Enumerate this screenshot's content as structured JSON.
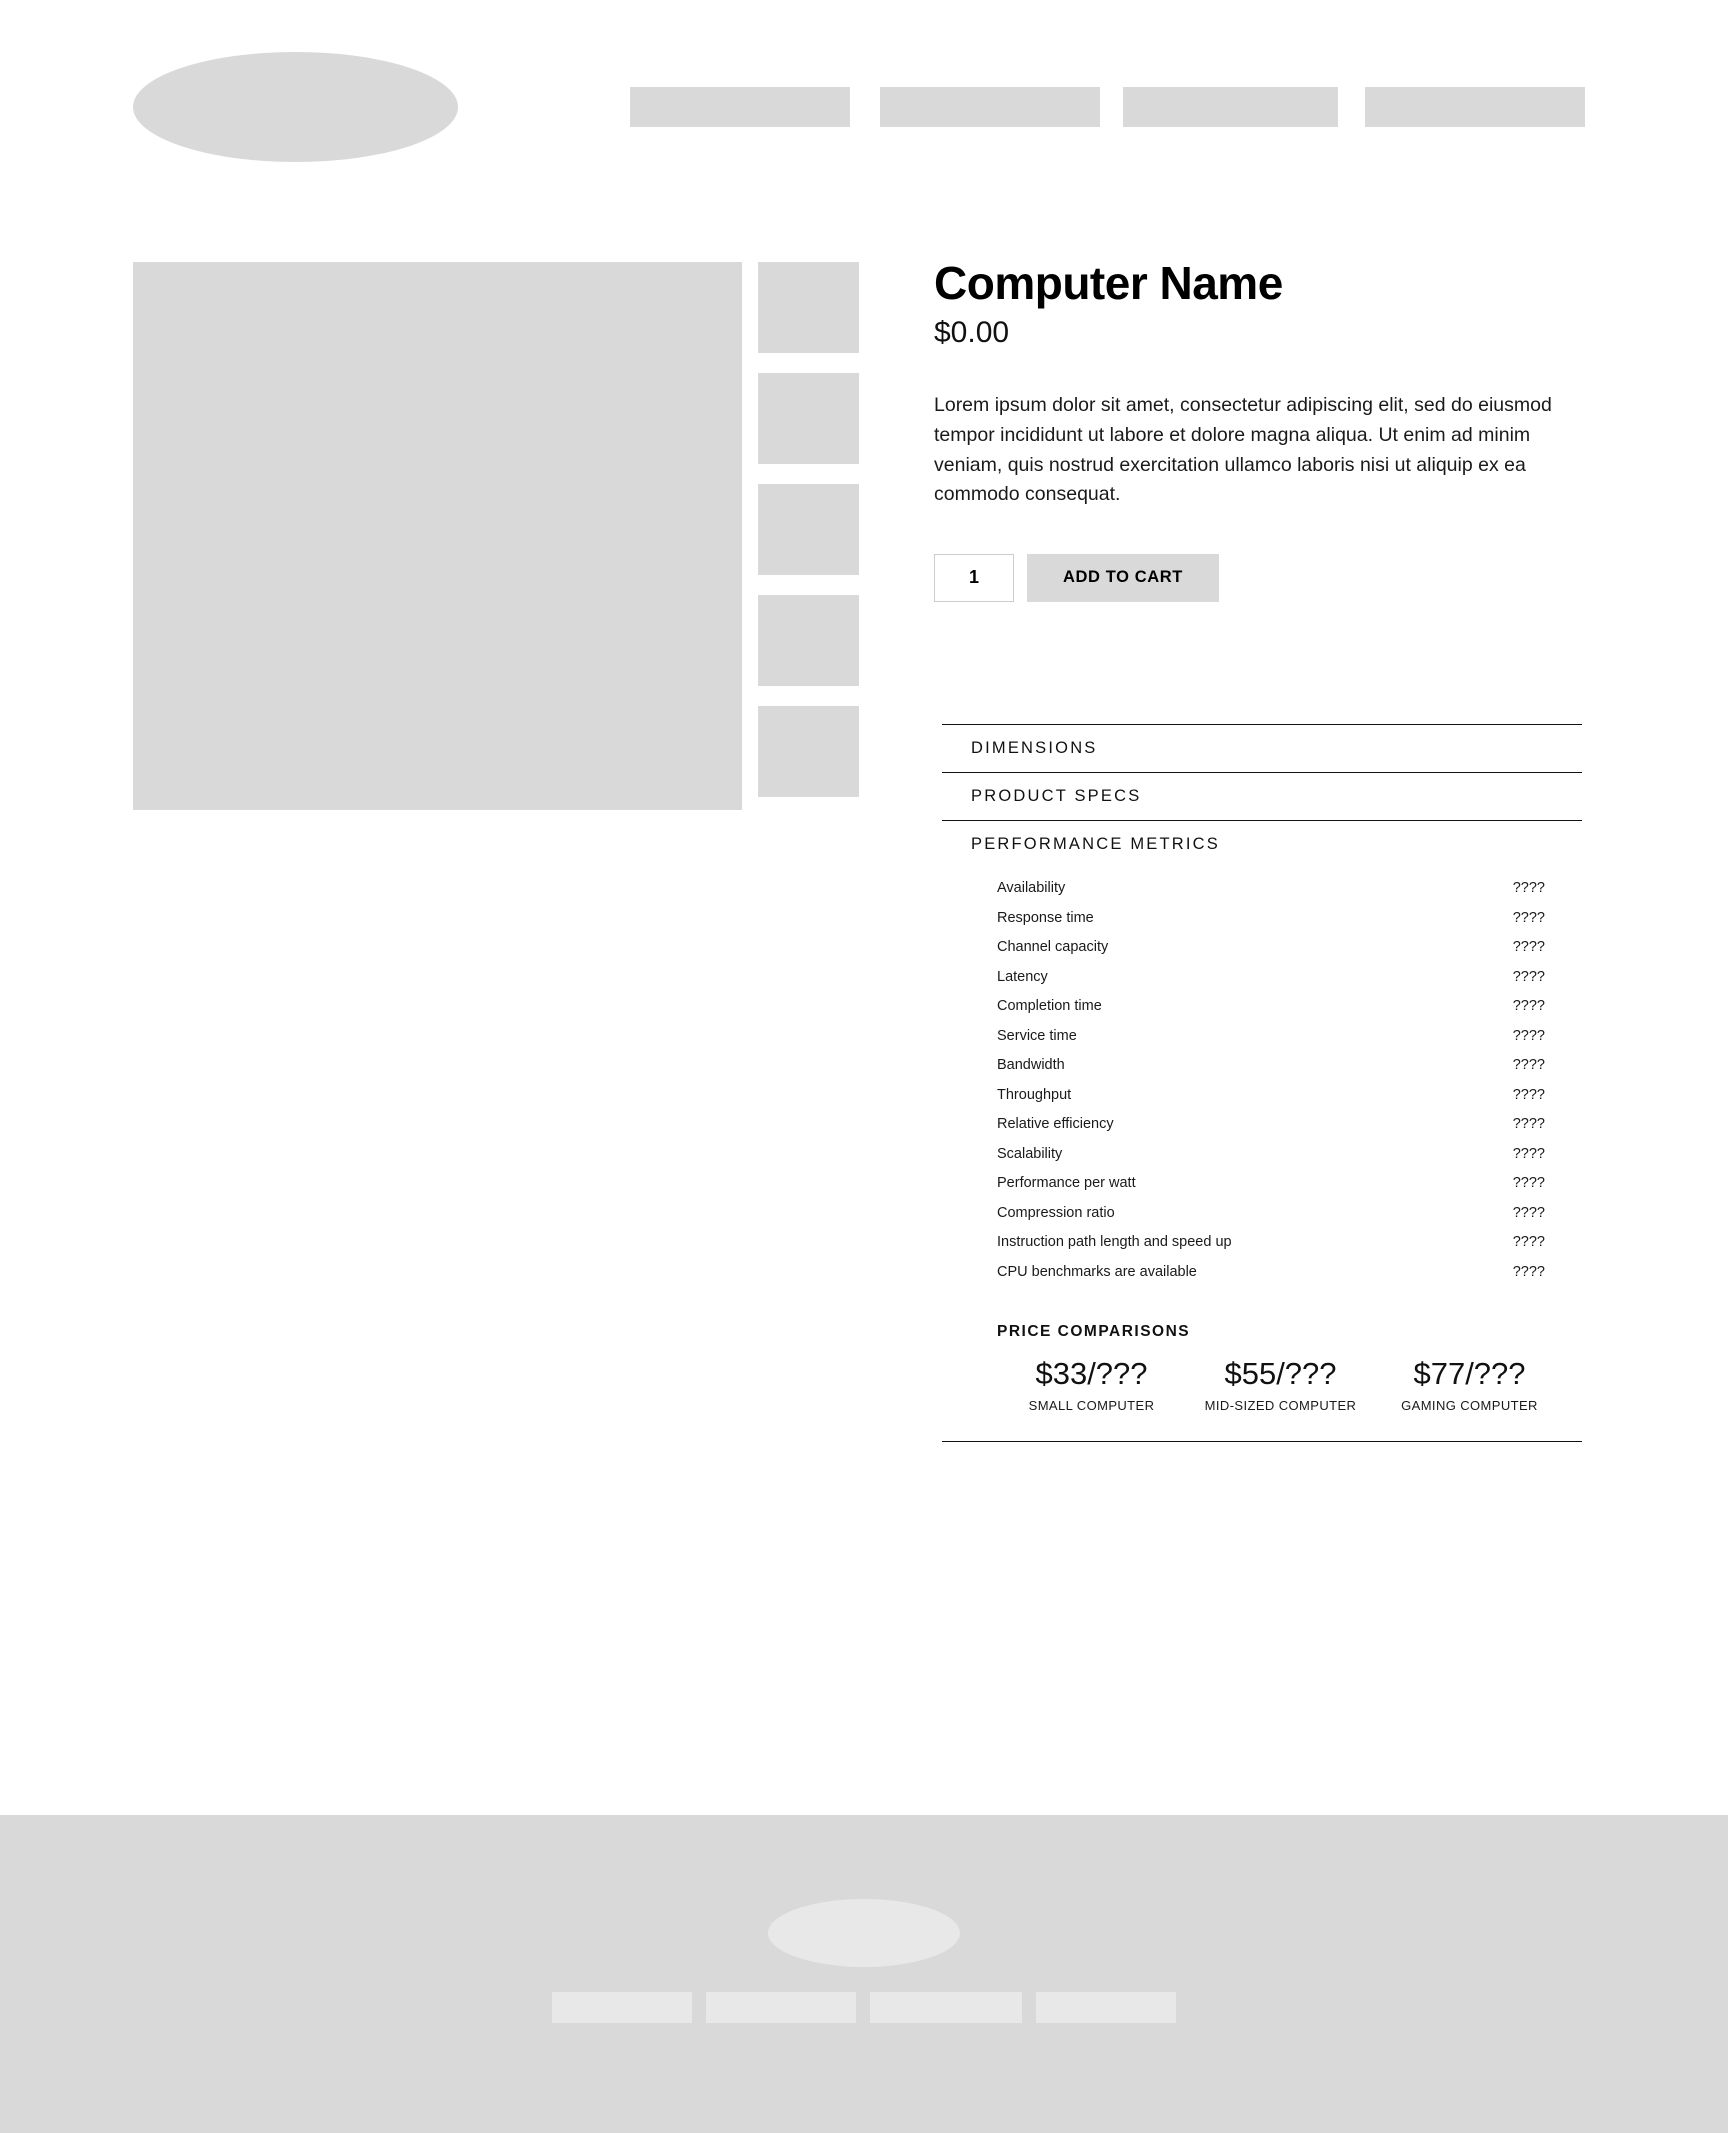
{
  "header": {
    "logo_name": "logo-placeholder",
    "nav_items": [
      {
        "name": "nav-item-1"
      },
      {
        "name": "nav-item-2"
      },
      {
        "name": "nav-item-3"
      },
      {
        "name": "nav-item-4"
      }
    ]
  },
  "gallery": {
    "main_image_name": "product-main-image",
    "thumbnails": [
      {
        "name": "product-thumbnail-1"
      },
      {
        "name": "product-thumbnail-2"
      },
      {
        "name": "product-thumbnail-3"
      },
      {
        "name": "product-thumbnail-4"
      },
      {
        "name": "product-thumbnail-5"
      }
    ]
  },
  "product": {
    "title": "Computer Name",
    "price": "$0.00",
    "description": "Lorem ipsum dolor sit amet, consectetur adipiscing elit, sed do eiusmod tempor incididunt ut labore et dolore magna aliqua. Ut enim ad minim veniam, quis nostrud exercitation ullamco laboris nisi ut aliquip ex ea commodo consequat.",
    "quantity": "1",
    "quantity_placeholder": "1",
    "add_to_cart_label": "ADD TO CART"
  },
  "accordion": {
    "dimensions_label": "DIMENSIONS",
    "product_specs_label": "PRODUCT SPECS",
    "performance_metrics_label": "PERFORMANCE METRICS",
    "metrics": [
      {
        "label": "Availability",
        "value": "????"
      },
      {
        "label": "Response time",
        "value": "????"
      },
      {
        "label": "Channel capacity",
        "value": "????"
      },
      {
        "label": "Latency",
        "value": "????"
      },
      {
        "label": "Completion time",
        "value": "????"
      },
      {
        "label": "Service time",
        "value": "????"
      },
      {
        "label": "Bandwidth",
        "value": "????"
      },
      {
        "label": "Throughput",
        "value": "????"
      },
      {
        "label": "Relative efficiency",
        "value": "????"
      },
      {
        "label": "Scalability",
        "value": "????"
      },
      {
        "label": "Performance per watt",
        "value": "????"
      },
      {
        "label": "Compression ratio",
        "value": "????"
      },
      {
        "label": "Instruction path length and speed up",
        "value": "????"
      },
      {
        "label": "CPU benchmarks are available",
        "value": "????"
      }
    ],
    "price_comparisons": {
      "title": "PRICE COMPARISONS",
      "items": [
        {
          "price": "$33/???",
          "label": "SMALL COMPUTER"
        },
        {
          "price": "$55/???",
          "label": "MID-SIZED COMPUTER"
        },
        {
          "price": "$77/???",
          "label": "GAMING COMPUTER"
        }
      ]
    }
  },
  "footer": {
    "logo_name": "footer-logo-placeholder",
    "links": [
      {
        "name": "footer-link-1"
      },
      {
        "name": "footer-link-2"
      },
      {
        "name": "footer-link-3"
      },
      {
        "name": "footer-link-4"
      }
    ]
  },
  "colors": {
    "placeholder_gray": "#d9d9d9",
    "footer_element_gray": "#e8e8e8",
    "rule_black": "#111111",
    "text_black": "#000000"
  }
}
